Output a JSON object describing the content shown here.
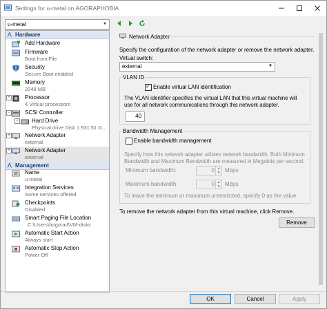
{
  "window": {
    "title": "Settings for u-metal on AGORAPHOBIA",
    "controls": [
      "minimize",
      "maximize",
      "close"
    ]
  },
  "vm_selector": {
    "value": "u-metal"
  },
  "nav_icons": [
    "back-arrow-icon",
    "forward-arrow-icon",
    "refresh-icon"
  ],
  "sidebar": {
    "hardware_header": "Hardware",
    "hardware_items": [
      {
        "icon": "add-hardware-icon",
        "label": "Add Hardware",
        "sub": ""
      },
      {
        "icon": "firmware-icon",
        "label": "Firmware",
        "sub": "Boot from File"
      },
      {
        "icon": "shield-icon",
        "label": "Security",
        "sub": "Secure Boot enabled"
      },
      {
        "icon": "memory-icon",
        "label": "Memory",
        "sub": "2048 MB"
      },
      {
        "icon": "processor-icon",
        "label": "Processor",
        "sub": "4 Virtual processors"
      },
      {
        "icon": "scsi-controller-icon",
        "label": "SCSI Controller",
        "sub": ""
      },
      {
        "icon": "hard-drive-icon",
        "label": "Hard Drive",
        "sub": "Physical drive Disk 1 931.51 G..."
      },
      {
        "icon": "network-adapter-icon",
        "label": "Network Adapter",
        "sub": "external"
      },
      {
        "icon": "network-adapter-icon",
        "label": "Network Adapter",
        "sub": "external"
      }
    ],
    "management_header": "Management",
    "management_items": [
      {
        "icon": "name-icon",
        "label": "Name",
        "sub": "u-metal"
      },
      {
        "icon": "integration-services-icon",
        "label": "Integration Services",
        "sub": "Some services offered"
      },
      {
        "icon": "checkpoints-icon",
        "label": "Checkpoints",
        "sub": "Disabled"
      },
      {
        "icon": "paging-file-icon",
        "label": "Smart Paging File Location",
        "sub": "C:\\Users\\bogorad\\VM-disks"
      },
      {
        "icon": "start-action-icon",
        "label": "Automatic Start Action",
        "sub": "Always start"
      },
      {
        "icon": "stop-action-icon",
        "label": "Automatic Stop Action",
        "sub": "Power Off"
      }
    ]
  },
  "panel": {
    "title": "Network Adapter",
    "description": "Specify the configuration of the network adapter or remove the network adapter.",
    "virtual_switch_label": "Virtual switch:",
    "virtual_switch_value": "external",
    "vlan": {
      "legend": "VLAN ID",
      "enable_label": "Enable virtual LAN identification",
      "enabled": true,
      "help": "The VLAN identifier specifies the virtual LAN that this virtual machine will use for all network communications through this network adapter.",
      "value": "40"
    },
    "bandwidth": {
      "legend": "Bandwidth Management",
      "enable_label": "Enable bandwidth management",
      "enabled": false,
      "help": "Specify how this network adapter utilizes network bandwidth. Both Minimum Bandwidth and Maximum Bandwidth are measured in Megabits per second.",
      "min_label": "Minimum bandwidth:",
      "min_value": "0",
      "min_unit": "Mbps",
      "max_label": "Maximum bandwidth:",
      "max_value": "0",
      "max_unit": "Mbps",
      "note": "To leave the minimum or maximum unrestricted, specify 0 as the value."
    },
    "remove_text": "To remove the network adapter from this virtual machine, click Remove.",
    "remove_button": "Remove"
  },
  "footer": {
    "ok": "OK",
    "cancel": "Cancel",
    "apply": "Apply"
  },
  "colors": {
    "section_header_bg": "#dde6f1",
    "selected_item_bg": "#e6e6e6",
    "accent_green": "#2e9a3c"
  }
}
